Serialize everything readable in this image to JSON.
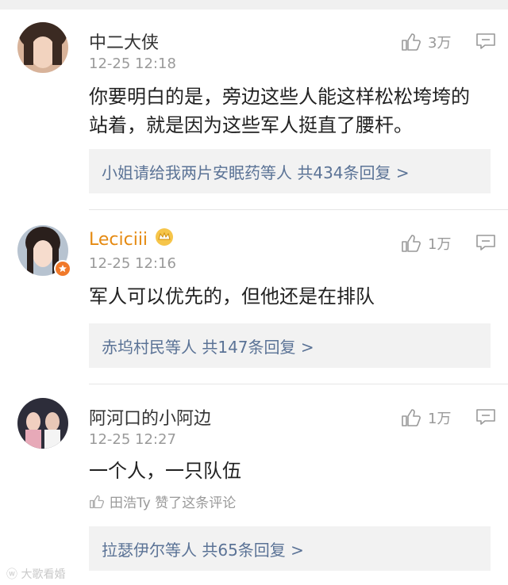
{
  "comments": [
    {
      "username": "中二大侠",
      "time": "12-25 12:18",
      "likes": "3万",
      "text": "你要明白的是，旁边这些人能这样松松垮垮的站着，就是因为这些军人挺直了腰杆。",
      "replies": "小姐请给我两片安眠药等人  共434条回复 >"
    },
    {
      "username": "Leciciii",
      "time": "12-25 12:16",
      "likes": "1万",
      "text": "军人可以优先的，但他还是在排队",
      "replies": "赤坞村民等人  共147条回复 >"
    },
    {
      "username": "阿河口的小阿边",
      "time": "12-25 12:27",
      "likes": "1万",
      "text": "一个人，一只队伍",
      "liked_by": "田浩Ty 赞了这条评论",
      "replies": "拉瑟伊尔等人  共65条回复 >"
    }
  ],
  "watermark": "大歌看婚",
  "colors": {
    "link": "#5b7396",
    "gold": "#e58a12",
    "muted": "#9a9a9a"
  }
}
